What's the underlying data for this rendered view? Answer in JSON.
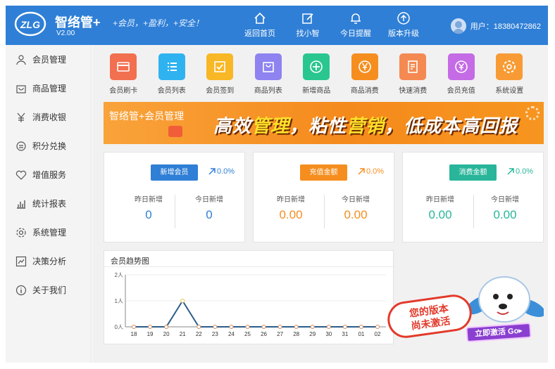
{
  "header": {
    "app_name": "智络管+",
    "version": "V2.00",
    "slogan": "+会员，+盈利，+安全！",
    "nav": [
      {
        "label": "返回首页",
        "icon": "home-icon"
      },
      {
        "label": "找小智",
        "icon": "edit-icon"
      },
      {
        "label": "今日提醒",
        "icon": "bell-icon"
      },
      {
        "label": "版本升级",
        "icon": "upgrade-icon"
      }
    ],
    "user_label": "用户：18380472862"
  },
  "sidebar": {
    "items": [
      {
        "label": "会员管理",
        "icon": "user-icon"
      },
      {
        "label": "商品管理",
        "icon": "bag-icon"
      },
      {
        "label": "消费收银",
        "icon": "yen-icon"
      },
      {
        "label": "积分兑换",
        "icon": "exchange-icon"
      },
      {
        "label": "增值服务",
        "icon": "heart-icon"
      },
      {
        "label": "统计报表",
        "icon": "bar-chart-icon"
      },
      {
        "label": "系统管理",
        "icon": "gear-icon"
      },
      {
        "label": "决策分析",
        "icon": "trend-icon"
      },
      {
        "label": "关于我们",
        "icon": "info-icon"
      }
    ]
  },
  "quick_actions": [
    {
      "label": "会员刷卡",
      "color": "#f26f4f",
      "icon": "card-icon"
    },
    {
      "label": "会员列表",
      "color": "#2fb3f0",
      "icon": "list-icon"
    },
    {
      "label": "会员签到",
      "color": "#f8b725",
      "icon": "check-icon"
    },
    {
      "label": "商品列表",
      "color": "#8e83f0",
      "icon": "shopping-bag-icon"
    },
    {
      "label": "新增商品",
      "color": "#29c78f",
      "icon": "plus-icon"
    },
    {
      "label": "商品消费",
      "color": "#f58e1f",
      "icon": "yen-coin-icon"
    },
    {
      "label": "快速消费",
      "color": "#f48a52",
      "icon": "fast-pay-icon"
    },
    {
      "label": "会员充值",
      "color": "#c56be6",
      "icon": "recharge-icon"
    },
    {
      "label": "系统设置",
      "color": "#f89b34",
      "icon": "settings-icon"
    }
  ],
  "banner": {
    "subtitle": "智络管+会员管理",
    "title_parts": [
      "高效",
      "管理",
      "，粘性",
      "营销",
      "，低成本高回报"
    ]
  },
  "stat_cards": [
    {
      "button": "新增会员",
      "button_color": "#2f7fd6",
      "trend": "0.0%",
      "yesterday_label": "昨日新增",
      "yesterday_value": "0",
      "today_label": "今日新增",
      "today_value": "0",
      "value_color": "#2f7fd6"
    },
    {
      "button": "充值金额",
      "button_color": "#f58e1f",
      "trend": "0.0%",
      "yesterday_label": "昨日新增",
      "yesterday_value": "0.00",
      "today_label": "今日新增",
      "today_value": "0.00",
      "value_color": "#f58e1f"
    },
    {
      "button": "消费金额",
      "button_color": "#29b59a",
      "trend": "0.0%",
      "yesterday_label": "昨日新增",
      "yesterday_value": "0.00",
      "today_label": "今日新增",
      "today_value": "0.00",
      "value_color": "#29b59a"
    }
  ],
  "chart": {
    "title": "会员趋势图"
  },
  "chart_data": {
    "type": "line",
    "title": "会员趋势图",
    "categories": [
      "18",
      "19",
      "20",
      "21",
      "22",
      "23",
      "24",
      "25",
      "26",
      "27",
      "28",
      "29",
      "30",
      "31",
      "01",
      "02"
    ],
    "series": [
      {
        "values": [
          0,
          0,
          0,
          1,
          0,
          0,
          0,
          0,
          0,
          0,
          0,
          0,
          0,
          0,
          0,
          0
        ]
      }
    ],
    "y_ticks": [
      "0人",
      "1人",
      "2人"
    ],
    "ylim": [
      0,
      2
    ],
    "grid": true,
    "line_color": "#2c5d8a"
  },
  "promo": {
    "text_line1": "您的版本",
    "text_line2": "尚未激活",
    "button": "立即激活 Go▸"
  }
}
